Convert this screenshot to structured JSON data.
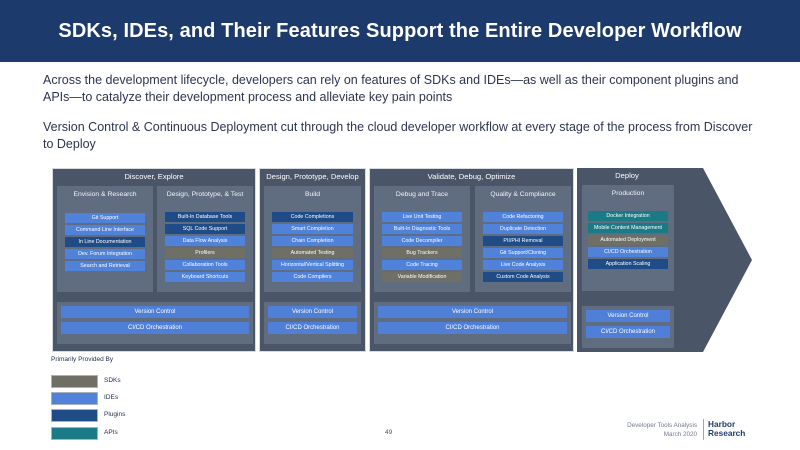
{
  "title": "SDKs, IDEs, and Their Features Support the Entire Developer Workflow",
  "intro": "Across the development lifecycle, developers can rely on features of SDKs and IDEs—as well as their component plugins and APIs—to catalyze their development process and alleviate key pain points",
  "subintro": "Version Control & Continuous Deployment cut through the cloud developer workflow at every stage of the process from Discover to Deploy",
  "colors": {
    "sdk": "#6f6f66",
    "ide": "#4f82d8",
    "plugin": "#1f4b86",
    "api": "#1a7a86",
    "stage": "#4a5568",
    "title_bar": "#1c3a6b"
  },
  "stages": [
    {
      "title": "Discover, Explore",
      "columns": [
        {
          "title": "Envision & Research",
          "items": [
            {
              "label": "Git Support",
              "kind": "ide"
            },
            {
              "label": "Command Line Interface",
              "kind": "ide"
            },
            {
              "label": "In Line Documentation",
              "kind": "plugin"
            },
            {
              "label": "Dev. Forum Integration",
              "kind": "ide"
            },
            {
              "label": "Search and Retrieval",
              "kind": "ide"
            }
          ]
        },
        {
          "title": "Design, Prototype, & Test",
          "items": [
            {
              "label": "Built-In Database Tools",
              "kind": "plugin"
            },
            {
              "label": "SQL Code Support",
              "kind": "plugin"
            },
            {
              "label": "Data Flow Analysis",
              "kind": "ide"
            },
            {
              "label": "Profilers",
              "kind": "sdk"
            },
            {
              "label": "Collaboration Tools",
              "kind": "ide"
            },
            {
              "label": "Keyboard Shortcuts",
              "kind": "ide"
            }
          ]
        }
      ],
      "bars": [
        "Version Control",
        "CI/CD Orchestration"
      ]
    },
    {
      "title": "Design, Prototype, Develop",
      "columns": [
        {
          "title": "Build",
          "items": [
            {
              "label": "Code Completions",
              "kind": "plugin"
            },
            {
              "label": "Smart Completion",
              "kind": "ide"
            },
            {
              "label": "Chain Completion",
              "kind": "ide"
            },
            {
              "label": "Automated Testing",
              "kind": "sdk"
            },
            {
              "label": "Horizontal/Vertical Splitting",
              "kind": "ide"
            },
            {
              "label": "Code Compilers",
              "kind": "ide"
            }
          ]
        }
      ],
      "bars": [
        "Version Control",
        "CI/CD Orchestration"
      ]
    },
    {
      "title": "Validate, Debug, Optimize",
      "columns": [
        {
          "title": "Debug and Trace",
          "items": [
            {
              "label": "Live Unit Testing",
              "kind": "ide"
            },
            {
              "label": "Built-In Diagnostic Tools",
              "kind": "ide"
            },
            {
              "label": "Code Decompiler",
              "kind": "ide"
            },
            {
              "label": "Bug Trackers",
              "kind": "sdk"
            },
            {
              "label": "Code Tracing",
              "kind": "ide"
            },
            {
              "label": "Variable Modification",
              "kind": "sdk"
            }
          ]
        },
        {
          "title": "Quality & Compliance",
          "items": [
            {
              "label": "Code Refactoring",
              "kind": "ide"
            },
            {
              "label": "Duplicate Detection",
              "kind": "ide"
            },
            {
              "label": "PII/PHI Removal",
              "kind": "plugin"
            },
            {
              "label": "Git Support/Cloning",
              "kind": "ide"
            },
            {
              "label": "Live Code Analysis",
              "kind": "ide"
            },
            {
              "label": "Custom Code Analysis",
              "kind": "plugin"
            }
          ]
        }
      ],
      "bars": [
        "Version Control",
        "CI/CD Orchestration"
      ]
    },
    {
      "title": "Deploy",
      "columns": [
        {
          "title": "Production",
          "items": [
            {
              "label": "Docker Integration",
              "kind": "api"
            },
            {
              "label": "Mobile Content Management",
              "kind": "api"
            },
            {
              "label": "Automated Deployment",
              "kind": "sdk"
            },
            {
              "label": "CI/CD Orchestration",
              "kind": "ide"
            },
            {
              "label": "Application Scaling",
              "kind": "plugin"
            }
          ]
        }
      ],
      "bars": [
        "Version Control",
        "CI/CD Orchestration"
      ]
    }
  ],
  "legend": {
    "title": "Primarily Provided By",
    "items": [
      {
        "label": "SDKs",
        "kind": "sdk"
      },
      {
        "label": "IDEs",
        "kind": "ide"
      },
      {
        "label": "Plugins",
        "kind": "plugin"
      },
      {
        "label": "APIs",
        "kind": "api"
      }
    ]
  },
  "footer": {
    "page_number": "49",
    "report": "Developer Tools Analysis",
    "date": "March 2020",
    "logo_line1": "Harbor",
    "logo_line2": "Research"
  }
}
